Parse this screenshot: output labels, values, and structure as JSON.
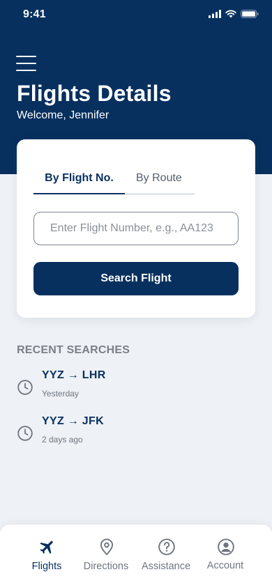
{
  "status_bar": {
    "time": "9:41"
  },
  "header": {
    "title": "Flights Details",
    "welcome": "Welcome, Jennifer"
  },
  "search": {
    "tabs": [
      {
        "label": "By Flight No.",
        "active": true
      },
      {
        "label": "By Route",
        "active": false
      }
    ],
    "input_placeholder": "Enter Flight Number, e.g., AA123",
    "input_value": "",
    "button_label": "Search Flight"
  },
  "recent": {
    "heading": "RECENT SEARCHES",
    "items": [
      {
        "route": "YYZ → LHR",
        "time": "Yesterday"
      },
      {
        "route": "YYZ → JFK",
        "time": "2 days ago"
      }
    ]
  },
  "bottom_nav": {
    "items": [
      {
        "label": "Flights",
        "icon": "airplane-icon",
        "active": true
      },
      {
        "label": "Directions",
        "icon": "location-pin-icon",
        "active": false
      },
      {
        "label": "Assistance",
        "icon": "help-circle-icon",
        "active": false
      },
      {
        "label": "Account",
        "icon": "user-circle-icon",
        "active": false
      }
    ]
  },
  "colors": {
    "primary": "#07305f",
    "background": "#eef1f5",
    "muted_text": "#6f7680"
  }
}
